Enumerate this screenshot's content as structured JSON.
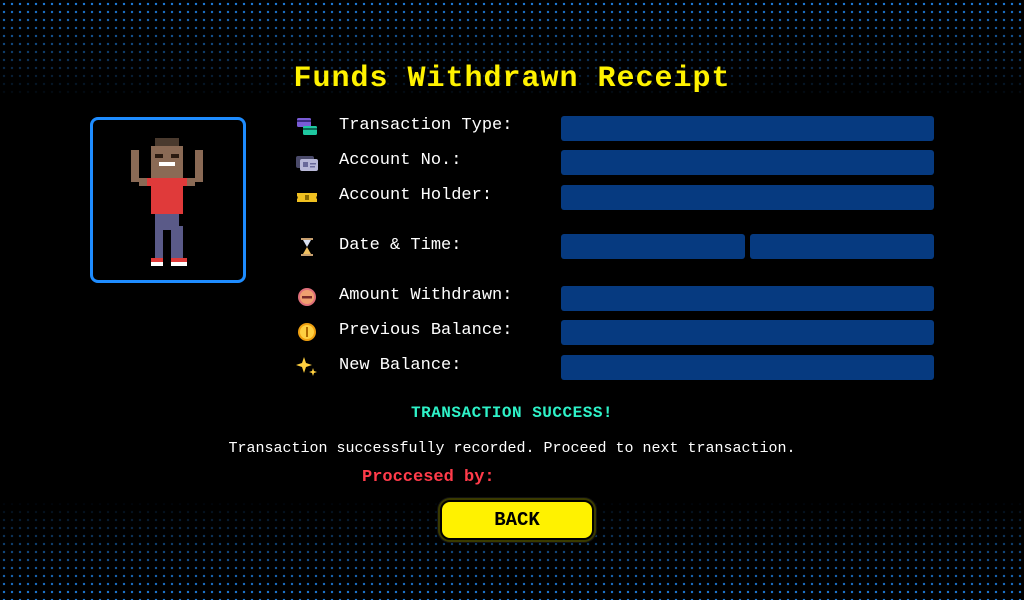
{
  "title": "Funds Withdrawn Receipt",
  "avatar": {
    "icon": "pixel-person-cheering-icon"
  },
  "fields": [
    {
      "label": "Transaction Type:",
      "icon": "credit-cards-icon",
      "value": ""
    },
    {
      "label": "Account No.:",
      "icon": "id-card-icon",
      "value": ""
    },
    {
      "label": "Account Holder:",
      "icon": "ticket-icon",
      "value": ""
    },
    {
      "label": "Date & Time:",
      "icon": "hourglass-icon",
      "date": "",
      "time": ""
    },
    {
      "label": "Amount Withdrawn:",
      "icon": "minus-coin-icon",
      "value": ""
    },
    {
      "label": "Previous Balance:",
      "icon": "coin-icon",
      "value": ""
    },
    {
      "label": "New Balance:",
      "icon": "sparkles-icon",
      "value": ""
    }
  ],
  "status": "TRANSACTION SUCCESS!",
  "message": "Transaction successfully recorded. Proceed to next transaction.",
  "processed_by_label": "Proccesed by:",
  "processed_by_value": "",
  "back_label": "BACK",
  "colors": {
    "title": "#fff200",
    "accent_blue": "#1e8cff",
    "field_bg": "#063a80",
    "status": "#2ef2c8",
    "processed": "#ff3b4a",
    "button_bg": "#fff200"
  }
}
